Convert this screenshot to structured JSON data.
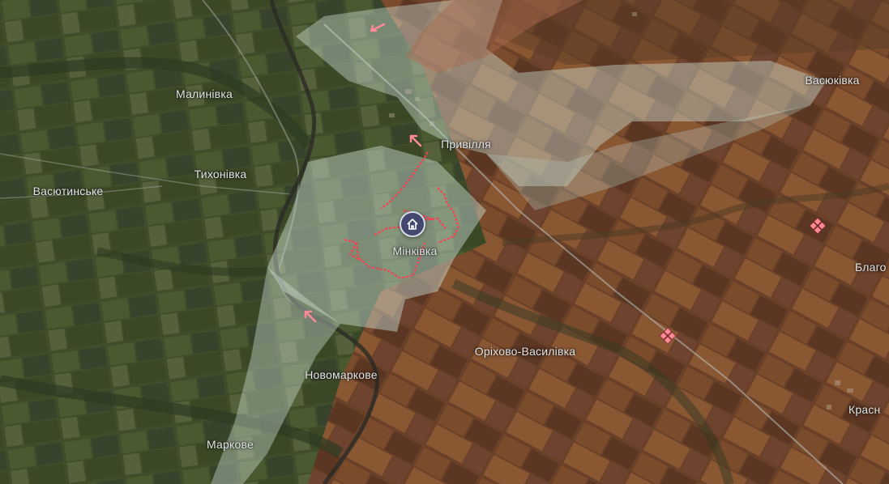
{
  "map": {
    "colors": {
      "farmland_dark": "#5b3b25",
      "farmland_mid": "#7a4b2e",
      "green_fields": "#3f4d2b",
      "controlled_overlay": "#cfe3d8",
      "advance_overlay": "#a86a50",
      "fortification": "#ff3b4e",
      "arrow": "#ff8a96",
      "pin_fill": "#43496e"
    },
    "places": [
      {
        "id": "malynivka",
        "name": "Малинівка"
      },
      {
        "id": "tykhonivka",
        "name": "Тихонівка"
      },
      {
        "id": "vasiutynske",
        "name": "Васютинське"
      },
      {
        "id": "pryvillia",
        "name": "Привілля"
      },
      {
        "id": "minkivka",
        "name": "Мінківка"
      },
      {
        "id": "orikhovo",
        "name": "Оріхово-Василівка"
      },
      {
        "id": "novomarkove",
        "name": "Новомаркове"
      },
      {
        "id": "markove",
        "name": "Маркове"
      },
      {
        "id": "vasiukivka",
        "name": "Васюківка"
      },
      {
        "id": "blaho",
        "name": "Благо"
      },
      {
        "id": "krasne",
        "name": "Красн"
      }
    ],
    "markers": {
      "settlement_pin_icon": "house-icon",
      "attack_arrow_icon": "arrow-icon",
      "point_marker_icon": "diamond-icon"
    }
  }
}
